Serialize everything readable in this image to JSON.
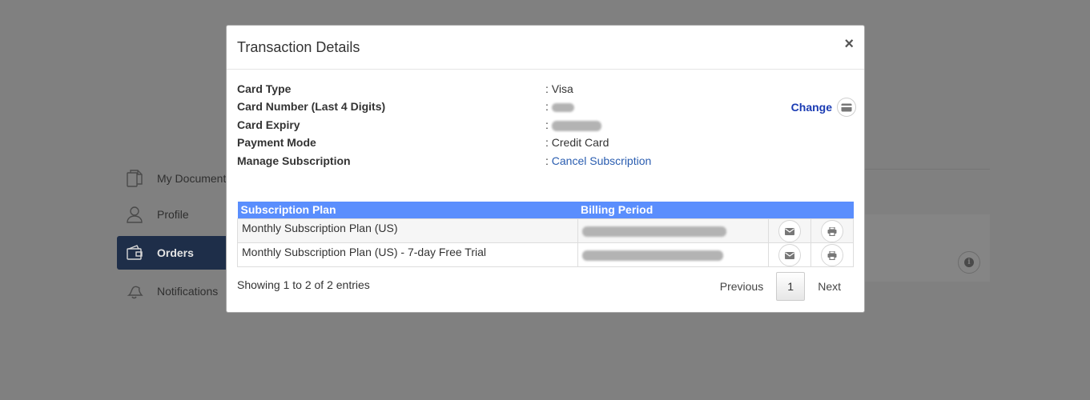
{
  "background": {
    "sidebar": [
      {
        "label": "My Documents",
        "icon": "document-icon"
      },
      {
        "label": "Profile",
        "icon": "user-icon"
      },
      {
        "label": "Orders",
        "icon": "wallet-icon"
      },
      {
        "label": "Notifications",
        "icon": "bell-icon"
      }
    ]
  },
  "modal": {
    "title": "Transaction Details",
    "close": "×",
    "details": [
      {
        "label": "Card Type",
        "value": ": Visa"
      },
      {
        "label": "Card Number (Last 4 Digits)",
        "value": ":"
      },
      {
        "label": "Card Expiry",
        "value": ":"
      },
      {
        "label": "Payment Mode",
        "value": ": Credit Card"
      },
      {
        "label": "Manage Subscription",
        "prefix": ": ",
        "link": "Cancel Subscription"
      }
    ],
    "change_label": "Change",
    "table": {
      "headers": [
        "Subscription Plan",
        "Billing Period",
        "",
        ""
      ],
      "rows": [
        {
          "plan": "Monthly Subscription Plan (US)"
        },
        {
          "plan": "Monthly Subscription Plan (US) - 7-day Free Trial"
        }
      ]
    },
    "entries_text": "Showing 1 to 2 of 2 entries",
    "pager": {
      "previous": "Previous",
      "current": "1",
      "next": "Next"
    }
  },
  "colors": {
    "header_bg": "#5a8efd",
    "active_sidebar": "#1e2e49",
    "link": "#2a5db0",
    "change": "#1a3bb3"
  }
}
